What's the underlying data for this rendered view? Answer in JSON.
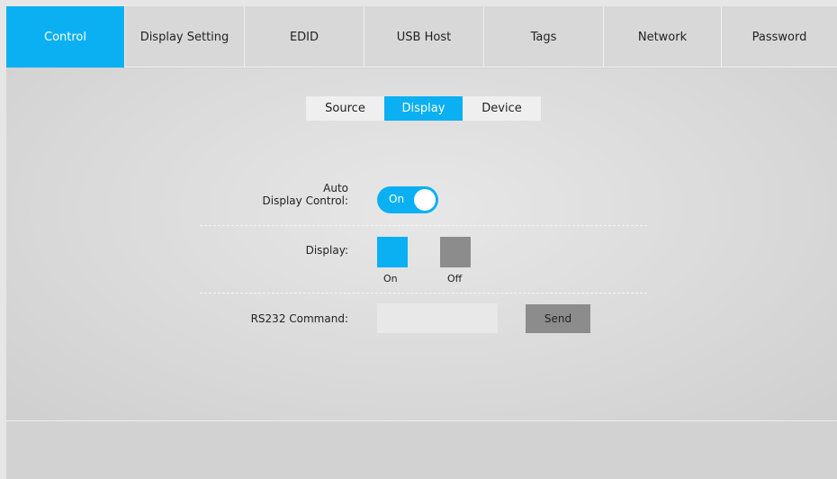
{
  "nav": {
    "tabs": [
      {
        "label": "Control",
        "active": true
      },
      {
        "label": "Display Setting",
        "active": false
      },
      {
        "label": "EDID",
        "active": false
      },
      {
        "label": "USB Host",
        "active": false
      },
      {
        "label": "Tags",
        "active": false
      },
      {
        "label": "Network",
        "active": false
      },
      {
        "label": "Password",
        "active": false
      }
    ]
  },
  "subtabs": [
    {
      "label": "Source",
      "active": false
    },
    {
      "label": "Display",
      "active": true
    },
    {
      "label": "Device",
      "active": false
    }
  ],
  "auto_display": {
    "label_line1": "Auto",
    "label_line2": "Display Control:",
    "toggle_text": "On",
    "enabled": true
  },
  "display_power": {
    "label": "Display:",
    "on_label": "On",
    "off_label": "Off"
  },
  "rs232": {
    "label": "RS232 Command:",
    "value": "",
    "send_label": "Send"
  },
  "colors": {
    "accent": "#0ab0f2",
    "inactive_button": "#8c8c8c"
  }
}
